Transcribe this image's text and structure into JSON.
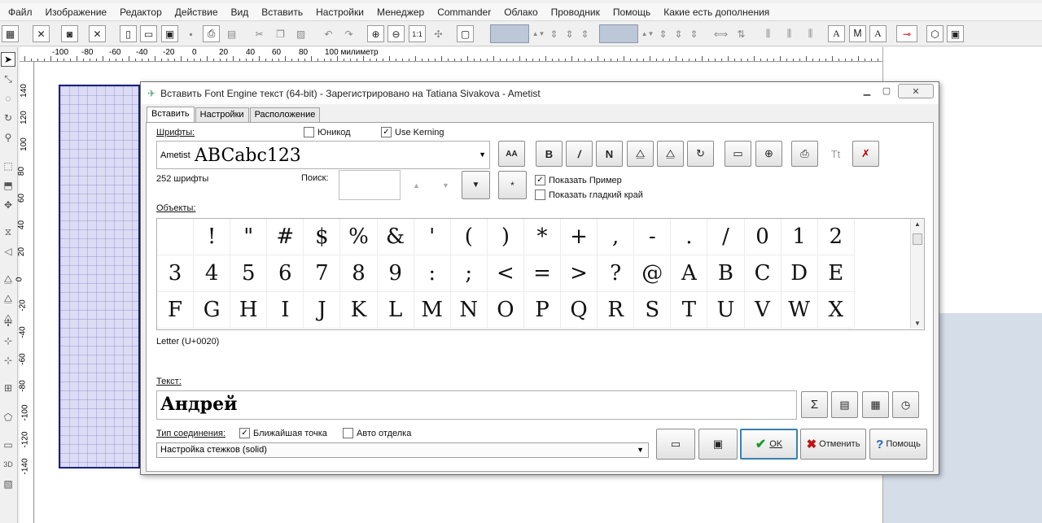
{
  "menu": [
    "Файл",
    "Изображение",
    "Редактор",
    "Действие",
    "Вид",
    "Вставить",
    "Настройки",
    "Менеджер",
    "Commander",
    "Облако",
    "Проводник",
    "Помощь",
    "Какие есть дополнения"
  ],
  "ruler_h": [
    "-100",
    "-80",
    "-60",
    "-40",
    "-20",
    "0",
    "20",
    "40",
    "60",
    "80",
    "100 милиметр"
  ],
  "ruler_v": [
    "140",
    "120",
    "100",
    "80",
    "60",
    "40",
    "20",
    "0",
    "-20",
    "-40",
    "-60",
    "-80",
    "-100",
    "-120",
    "-140"
  ],
  "dialog": {
    "title": "Вставить Font Engine  текст (64-bit) - Зарегистрировано на Tatiana Sivakova - Ametist",
    "tabs": [
      "Вставить",
      "Настройки",
      "Расположение"
    ],
    "fonts_label": "Шрифты:",
    "unicode_label": "Юникод",
    "use_kerning_label": "Use Kerning",
    "font_name": "Ametist",
    "font_sample": "ABCabc123",
    "font_count": "252 шрифты",
    "search_label": "Поиск:",
    "show_sample_label": "Показать Пример",
    "show_smooth_label": "Показать гладкий край",
    "objects_label": "Объекты:",
    "glyphs": [
      " ",
      "!",
      "\"",
      "#",
      "$",
      "%",
      "&",
      "'",
      "(",
      ")",
      "*",
      "+",
      ",",
      "-",
      ".",
      "/",
      "0",
      "1",
      "2",
      "3",
      "4",
      "5",
      "6",
      "7",
      "8",
      "9",
      ":",
      ";",
      "<",
      "=",
      ">",
      "?",
      "@",
      "A",
      "B",
      "C",
      "D",
      "E",
      "F",
      "G",
      "H",
      "I",
      "J",
      "K",
      "L",
      "M",
      "N",
      "O",
      "P",
      "Q",
      "R",
      "S",
      "T",
      "U",
      "V",
      "W",
      "X"
    ],
    "letter_info": "Letter    (U+0020)",
    "text_label": "Текст:",
    "text_value": "Андрей",
    "join_type_label": "Тип соединения:",
    "nearest_point_label": "Ближайшая точка",
    "auto_trim_label": "Авто отделка",
    "join_select_value": "Настройка стежков (solid)",
    "ok_label": "OK",
    "cancel_label": "Отменить",
    "help_label": "Помощь"
  }
}
